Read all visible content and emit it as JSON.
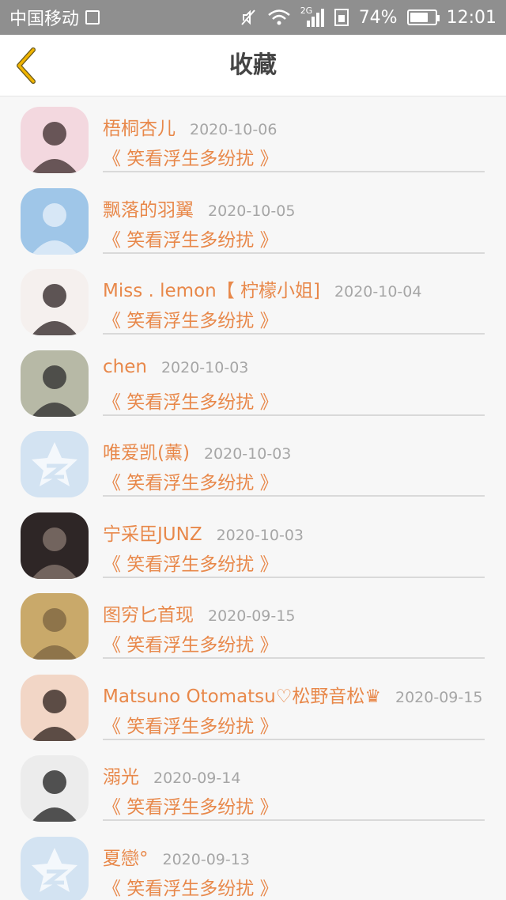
{
  "status_bar": {
    "carrier": "中国移动",
    "network": "2G",
    "battery_percent": "74%",
    "battery_level": 0.74,
    "time": "12:01"
  },
  "nav": {
    "title": "收藏"
  },
  "favorites": [
    {
      "username": "梧桐杏儿",
      "date": "2020-10-06",
      "work": "《 笑看浮生多纷扰 》",
      "avatar": "photo"
    },
    {
      "username": "飘落的羽翼",
      "date": "2020-10-05",
      "work": "《 笑看浮生多纷扰 》",
      "avatar": "photo"
    },
    {
      "username": "Miss . lemon【 柠檬小姐]",
      "date": "2020-10-04",
      "work": "《 笑看浮生多纷扰 》",
      "avatar": "photo"
    },
    {
      "username": "chen",
      "date": "2020-10-03",
      "work": "《 笑看浮生多纷扰 》",
      "avatar": "photo"
    },
    {
      "username": "唯爱凯(薰)",
      "date": "2020-10-03",
      "work": "《 笑看浮生多纷扰 》",
      "avatar": "default"
    },
    {
      "username": "宁采臣JUNZ",
      "date": "2020-10-03",
      "work": "《 笑看浮生多纷扰 》",
      "avatar": "photo"
    },
    {
      "username": "图穷匕首现",
      "date": "2020-09-15",
      "work": "《 笑看浮生多纷扰 》",
      "avatar": "photo"
    },
    {
      "username": "Matsuno Otomatsu♡松野音松♛",
      "date": "2020-09-15",
      "work": "《 笑看浮生多纷扰 》",
      "avatar": "photo"
    },
    {
      "username": "溺光",
      "date": "2020-09-14",
      "work": "《 笑看浮生多纷扰 》",
      "avatar": "photo"
    },
    {
      "username": "夏戀°",
      "date": "2020-09-13",
      "work": "《 笑看浮生多纷扰 》",
      "avatar": "default"
    }
  ],
  "colors": {
    "accent": "#e8884a",
    "date_gray": "#a6a6a6",
    "status_bar": "#8f8f8f",
    "back_arrow": "#f0b400"
  },
  "icons": {
    "back": "chevron-left-icon",
    "default_avatar": "qzone-star-icon"
  }
}
